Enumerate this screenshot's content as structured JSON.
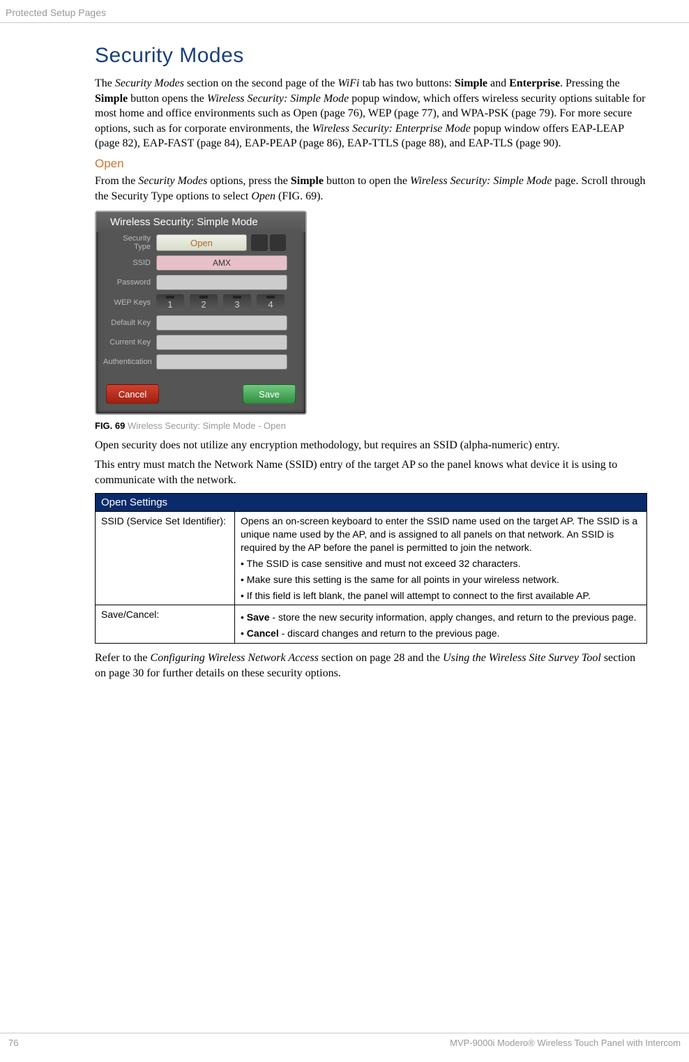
{
  "header": "Protected Setup Pages",
  "h1": "Security Modes",
  "intro_parts": {
    "t1": "The ",
    "i1": "Security Modes",
    "t2": " section on the second page of the ",
    "i2": "WiFi",
    "t3": " tab has two buttons: ",
    "b1": "Simple",
    "t4": " and ",
    "b2": "Enterprise",
    "t5": ". Pressing the ",
    "b3": "Simple",
    "t6": " button opens the ",
    "i3": "Wireless Security: Simple Mode",
    "t7": " popup window, which offers wireless security options suitable for most home and office environments such as Open (page 76), WEP (page 77), and WPA-PSK (page 79). For more secure options, such as for corporate environments, the ",
    "i4": "Wireless Security: Enterprise Mode",
    "t8": " popup window offers EAP-LEAP (page 82), EAP-FAST (page 84), EAP-PEAP (page 86), EAP-TTLS (page 88), and EAP-TLS (page 90)."
  },
  "h2": "Open",
  "open_para_parts": {
    "t1": "From the ",
    "i1": "Security Modes",
    "t2": " options, press the ",
    "b1": "Simple",
    "t3": " button to open the ",
    "i2": "Wireless Security: Simple Mode",
    "t4": " page. Scroll through the Security Type options to select ",
    "i3": "Open",
    "t5": " (FIG. 69)."
  },
  "fig": {
    "title": "Wireless Security: Simple Mode",
    "labels": {
      "security_type": "Security\nType",
      "ssid": "SSID",
      "password": "Password",
      "wep_keys": "WEP Keys",
      "default_key": "Default Key",
      "current_key": "Current Key",
      "authentication": "Authentication"
    },
    "select_value": "Open",
    "ssid_value": "AMX",
    "wep": [
      "1",
      "2",
      "3",
      "4"
    ],
    "cancel": "Cancel",
    "save": "Save"
  },
  "fig_caption": {
    "num": "FIG. 69",
    "desc": "  Wireless Security: Simple Mode - Open"
  },
  "para2": "Open security does not utilize any encryption methodology, but requires an SSID (alpha-numeric) entry.",
  "para3": "This entry must match the Network Name (SSID) entry of the target AP so the panel knows what device it is using to communicate with the network.",
  "table": {
    "header": "Open Settings",
    "row1_label": "SSID (Service Set Identifier):",
    "row1_body": "Opens an on-screen keyboard to enter the SSID name used on the target AP. The SSID is a unique name used by the AP, and is assigned to all panels on that network. An SSID is required by the AP before the panel is permitted to join the network.",
    "row1_bullets": [
      "The SSID is case sensitive and must not exceed 32 characters.",
      "Make sure this setting is the same for all points in your wireless network.",
      "If this field is left blank, the panel will attempt to connect to the first available AP."
    ],
    "row2_label": "Save/Cancel:",
    "row2_b1_bold": "Save",
    "row2_b1_rest": " - store the new security information, apply changes, and return to the previous page.",
    "row2_b2_bold": "Cancel",
    "row2_b2_rest": " - discard changes and return to the previous page."
  },
  "closing_parts": {
    "t1": "Refer to the ",
    "i1": "Configuring Wireless Network Access",
    "t2": " section on page 28 and the ",
    "i2": "Using the Wireless Site Survey Tool",
    "t3": " section on page 30 for further details on these security options."
  },
  "footer": {
    "page": "76",
    "product": "MVP-9000i Modero® Wireless Touch Panel with Intercom"
  }
}
